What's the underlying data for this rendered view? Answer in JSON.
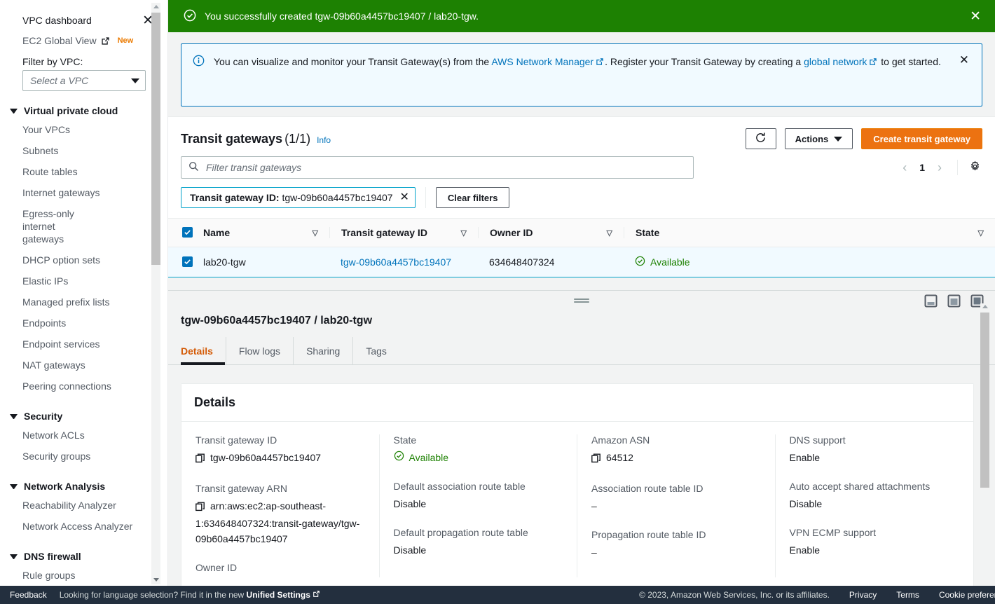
{
  "flash": {
    "icon": "check-circle-icon",
    "message": "You successfully created tgw-09b60a4457bc19407 / lab20-tgw.",
    "close_label": "✕",
    "bg_color": "#1d8102"
  },
  "info_banner": {
    "icon": "info-circle-icon",
    "text_before_link1": "You can visualize and monitor your Transit Gateway(s) from the ",
    "link1": "AWS Network Manager",
    "text_between": ". Register your Transit Gateway by creating a ",
    "link2": "global network",
    "text_after": " to get started.",
    "close_label": "✕",
    "border_color": "#0073bb",
    "bg_color": "#f1faff"
  },
  "sidebar": {
    "dashboard_label": "VPC dashboard",
    "dashboard_close": "✕",
    "global_view_label": "EC2 Global View",
    "global_view_badge": "New",
    "filter_label": "Filter by VPC:",
    "vpc_select_placeholder": "Select a VPC",
    "groups": [
      {
        "name": "Virtual private cloud",
        "items": [
          "Your VPCs",
          "Subnets",
          "Route tables",
          "Internet gateways",
          "Egress-only internet gateways",
          "DHCP option sets",
          "Elastic IPs",
          "Managed prefix lists",
          "Endpoints",
          "Endpoint services",
          "NAT gateways",
          "Peering connections"
        ]
      },
      {
        "name": "Security",
        "items": [
          "Network ACLs",
          "Security groups"
        ]
      },
      {
        "name": "Network Analysis",
        "items": [
          "Reachability Analyzer",
          "Network Access Analyzer"
        ]
      },
      {
        "name": "DNS firewall",
        "items": [
          "Rule groups"
        ]
      }
    ]
  },
  "table_panel": {
    "title": "Transit gateways",
    "count": "(1/1)",
    "info_link": "Info",
    "refresh_icon": "refresh-icon",
    "actions_label": "Actions",
    "create_label": "Create transit gateway",
    "search_placeholder": "Filter transit gateways",
    "search_value": "",
    "filter_token_key": "Transit gateway ID:",
    "filter_token_value": "tgw-09b60a4457bc19407",
    "clear_filters_label": "Clear filters",
    "page_number": "1",
    "columns": [
      "Name",
      "Transit gateway ID",
      "Owner ID",
      "State"
    ],
    "rows": [
      {
        "selected": true,
        "name": "lab20-tgw",
        "tgw_id": "tgw-09b60a4457bc19407",
        "owner_id": "634648407324",
        "state": "Available"
      }
    ]
  },
  "split_panel": {
    "title": "tgw-09b60a4457bc19407 / lab20-tgw",
    "tabs": [
      {
        "label": "Details",
        "active": true
      },
      {
        "label": "Flow logs",
        "active": false
      },
      {
        "label": "Sharing",
        "active": false
      },
      {
        "label": "Tags",
        "active": false
      }
    ],
    "details_heading": "Details",
    "columns": [
      {
        "fields": [
          {
            "label": "Transit gateway ID",
            "value": "tgw-09b60a4457bc19407",
            "copy": true
          },
          {
            "label": "Transit gateway ARN",
            "value": "arn:aws:ec2:ap-southeast-1:634648407324:transit-gateway/tgw-09b60a4457bc19407",
            "copy": true
          },
          {
            "label": "Owner ID",
            "value": "",
            "copy": false
          }
        ]
      },
      {
        "fields": [
          {
            "label": "State",
            "value": "Available",
            "status": "success"
          },
          {
            "label": "Default association route table",
            "value": "Disable"
          },
          {
            "label": "Default propagation route table",
            "value": "Disable"
          }
        ]
      },
      {
        "fields": [
          {
            "label": "Amazon ASN",
            "value": "64512",
            "copy": true
          },
          {
            "label": "Association route table ID",
            "value": "–"
          },
          {
            "label": "Propagation route table ID",
            "value": "–"
          }
        ]
      },
      {
        "fields": [
          {
            "label": "DNS support",
            "value": "Enable"
          },
          {
            "label": "Auto accept shared attachments",
            "value": "Disable"
          },
          {
            "label": "VPN ECMP support",
            "value": "Enable"
          }
        ]
      }
    ],
    "panel_icons": [
      "split-panel-bottom-icon",
      "split-panel-medium-icon",
      "split-panel-large-icon"
    ]
  },
  "footer": {
    "feedback": "Feedback",
    "language_prefix": "Looking for language selection? Find it in the new ",
    "language_link": "Unified Settings",
    "copyright": "© 2023, Amazon Web Services, Inc. or its affiliates.",
    "privacy": "Privacy",
    "terms": "Terms",
    "cookie": "Cookie preferences"
  },
  "colors": {
    "accent_orange": "#ec7211",
    "link_blue": "#0073bb",
    "success_green": "#1d8102",
    "navy": "#232f3e"
  }
}
